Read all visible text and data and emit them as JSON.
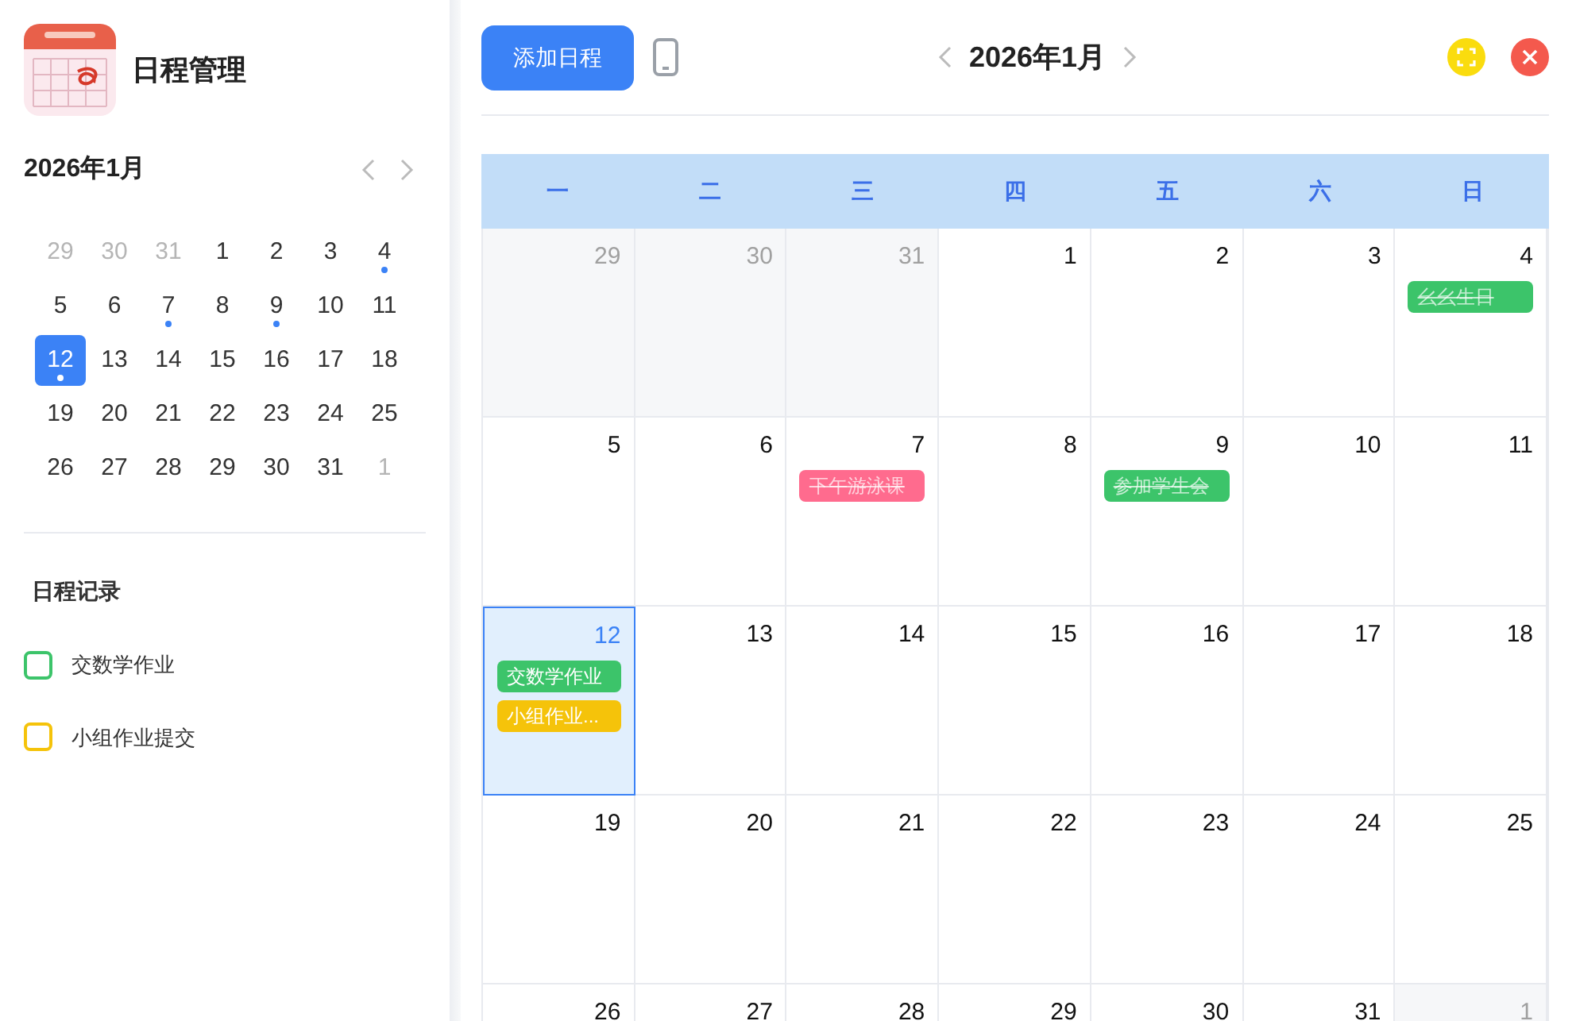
{
  "app": {
    "title": "日程管理"
  },
  "mini_calendar": {
    "title": "2026年1月",
    "days": [
      {
        "label": "29",
        "outside": true,
        "has_event": false,
        "selected": false
      },
      {
        "label": "30",
        "outside": true,
        "has_event": false,
        "selected": false
      },
      {
        "label": "31",
        "outside": true,
        "has_event": false,
        "selected": false
      },
      {
        "label": "1",
        "outside": false,
        "has_event": false,
        "selected": false
      },
      {
        "label": "2",
        "outside": false,
        "has_event": false,
        "selected": false
      },
      {
        "label": "3",
        "outside": false,
        "has_event": false,
        "selected": false
      },
      {
        "label": "4",
        "outside": false,
        "has_event": true,
        "selected": false
      },
      {
        "label": "5",
        "outside": false,
        "has_event": false,
        "selected": false
      },
      {
        "label": "6",
        "outside": false,
        "has_event": false,
        "selected": false
      },
      {
        "label": "7",
        "outside": false,
        "has_event": true,
        "selected": false
      },
      {
        "label": "8",
        "outside": false,
        "has_event": false,
        "selected": false
      },
      {
        "label": "9",
        "outside": false,
        "has_event": true,
        "selected": false
      },
      {
        "label": "10",
        "outside": false,
        "has_event": false,
        "selected": false
      },
      {
        "label": "11",
        "outside": false,
        "has_event": false,
        "selected": false
      },
      {
        "label": "12",
        "outside": false,
        "has_event": true,
        "selected": true
      },
      {
        "label": "13",
        "outside": false,
        "has_event": false,
        "selected": false
      },
      {
        "label": "14",
        "outside": false,
        "has_event": false,
        "selected": false
      },
      {
        "label": "15",
        "outside": false,
        "has_event": false,
        "selected": false
      },
      {
        "label": "16",
        "outside": false,
        "has_event": false,
        "selected": false
      },
      {
        "label": "17",
        "outside": false,
        "has_event": false,
        "selected": false
      },
      {
        "label": "18",
        "outside": false,
        "has_event": false,
        "selected": false
      },
      {
        "label": "19",
        "outside": false,
        "has_event": false,
        "selected": false
      },
      {
        "label": "20",
        "outside": false,
        "has_event": false,
        "selected": false
      },
      {
        "label": "21",
        "outside": false,
        "has_event": false,
        "selected": false
      },
      {
        "label": "22",
        "outside": false,
        "has_event": false,
        "selected": false
      },
      {
        "label": "23",
        "outside": false,
        "has_event": false,
        "selected": false
      },
      {
        "label": "24",
        "outside": false,
        "has_event": false,
        "selected": false
      },
      {
        "label": "25",
        "outside": false,
        "has_event": false,
        "selected": false
      },
      {
        "label": "26",
        "outside": false,
        "has_event": false,
        "selected": false
      },
      {
        "label": "27",
        "outside": false,
        "has_event": false,
        "selected": false
      },
      {
        "label": "28",
        "outside": false,
        "has_event": false,
        "selected": false
      },
      {
        "label": "29",
        "outside": false,
        "has_event": false,
        "selected": false
      },
      {
        "label": "30",
        "outside": false,
        "has_event": false,
        "selected": false
      },
      {
        "label": "31",
        "outside": false,
        "has_event": false,
        "selected": false
      },
      {
        "label": "1",
        "outside": true,
        "has_event": false,
        "selected": false
      }
    ]
  },
  "records": {
    "title": "日程记录",
    "items": [
      {
        "label": "交数学作业",
        "color": "#3cc46a",
        "checked": false
      },
      {
        "label": "小组作业提交",
        "color": "#f5c30a",
        "checked": false
      }
    ]
  },
  "toolbar": {
    "add_button": "添加日程",
    "month_title": "2026年1月"
  },
  "weekdays": [
    "一",
    "二",
    "三",
    "四",
    "五",
    "六",
    "日"
  ],
  "calendar": {
    "days": [
      {
        "label": "29",
        "outside": true,
        "selected": false
      },
      {
        "label": "30",
        "outside": true,
        "selected": false
      },
      {
        "label": "31",
        "outside": true,
        "selected": false
      },
      {
        "label": "1",
        "outside": false,
        "selected": false
      },
      {
        "label": "2",
        "outside": false,
        "selected": false
      },
      {
        "label": "3",
        "outside": false,
        "selected": false
      },
      {
        "label": "4",
        "outside": false,
        "selected": false,
        "events": [
          {
            "title": "幺幺生日",
            "color": "#3cc46a",
            "done": true
          }
        ]
      },
      {
        "label": "5",
        "outside": false,
        "selected": false
      },
      {
        "label": "6",
        "outside": false,
        "selected": false
      },
      {
        "label": "7",
        "outside": false,
        "selected": false,
        "events": [
          {
            "title": "下午游泳课",
            "color": "#ff6b8e",
            "done": true
          }
        ]
      },
      {
        "label": "8",
        "outside": false,
        "selected": false
      },
      {
        "label": "9",
        "outside": false,
        "selected": false,
        "events": [
          {
            "title": "参加学生会",
            "color": "#3cc46a",
            "done": true
          }
        ]
      },
      {
        "label": "10",
        "outside": false,
        "selected": false
      },
      {
        "label": "11",
        "outside": false,
        "selected": false
      },
      {
        "label": "12",
        "outside": false,
        "selected": true,
        "events": [
          {
            "title": "交数学作业",
            "color": "#3cc46a",
            "done": false
          },
          {
            "title": "小组作业...",
            "color": "#f5c30a",
            "done": false
          }
        ]
      },
      {
        "label": "13",
        "outside": false,
        "selected": false
      },
      {
        "label": "14",
        "outside": false,
        "selected": false
      },
      {
        "label": "15",
        "outside": false,
        "selected": false
      },
      {
        "label": "16",
        "outside": false,
        "selected": false
      },
      {
        "label": "17",
        "outside": false,
        "selected": false
      },
      {
        "label": "18",
        "outside": false,
        "selected": false
      },
      {
        "label": "19",
        "outside": false,
        "selected": false
      },
      {
        "label": "20",
        "outside": false,
        "selected": false
      },
      {
        "label": "21",
        "outside": false,
        "selected": false
      },
      {
        "label": "22",
        "outside": false,
        "selected": false
      },
      {
        "label": "23",
        "outside": false,
        "selected": false
      },
      {
        "label": "24",
        "outside": false,
        "selected": false
      },
      {
        "label": "25",
        "outside": false,
        "selected": false
      },
      {
        "label": "26",
        "outside": false,
        "selected": false
      },
      {
        "label": "27",
        "outside": false,
        "selected": false
      },
      {
        "label": "28",
        "outside": false,
        "selected": false
      },
      {
        "label": "29",
        "outside": false,
        "selected": false
      },
      {
        "label": "30",
        "outside": false,
        "selected": false
      },
      {
        "label": "31",
        "outside": false,
        "selected": false
      },
      {
        "label": "1",
        "outside": true,
        "selected": false
      }
    ]
  }
}
